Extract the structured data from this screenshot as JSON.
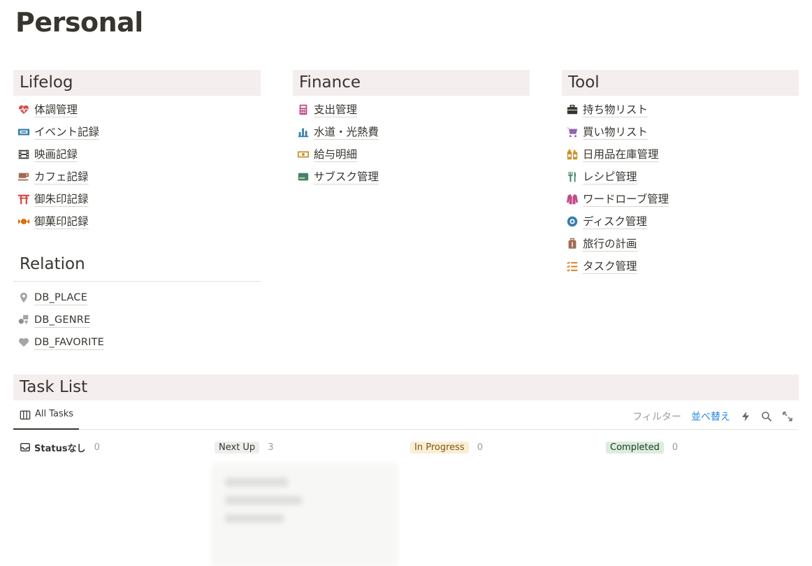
{
  "page": {
    "title": "Personal"
  },
  "lifelog": {
    "title": "Lifelog",
    "items": [
      {
        "label": "体調管理",
        "icon": "heart-pulse-icon",
        "color": "#d44c47"
      },
      {
        "label": "イベント記録",
        "icon": "ticket-icon",
        "color": "#337ea9"
      },
      {
        "label": "映画記録",
        "icon": "film-icon",
        "color": "#37352f"
      },
      {
        "label": "カフェ記録",
        "icon": "coffee-icon",
        "color": "#9f6b53"
      },
      {
        "label": "御朱印記録",
        "icon": "torii-icon",
        "color": "#d44c47"
      },
      {
        "label": "御菓印記録",
        "icon": "candy-icon",
        "color": "#d9730d"
      }
    ]
  },
  "relation": {
    "title": "Relation",
    "items": [
      {
        "label": "DB_PLACE",
        "icon": "location-pin-icon",
        "color": "#9b9a97"
      },
      {
        "label": "DB_GENRE",
        "icon": "shapes-icon",
        "color": "#9b9a97"
      },
      {
        "label": "DB_FAVORITE",
        "icon": "heart-icon",
        "color": "#9b9a97"
      }
    ]
  },
  "finance": {
    "title": "Finance",
    "items": [
      {
        "label": "支出管理",
        "icon": "calculator-icon",
        "color": "#c14c8a"
      },
      {
        "label": "水道・光熱費",
        "icon": "bar-chart-icon",
        "color": "#337ea9"
      },
      {
        "label": "給与明細",
        "icon": "money-icon",
        "color": "#cb912f"
      },
      {
        "label": "サブスク管理",
        "icon": "card-icon",
        "color": "#448361"
      }
    ]
  },
  "tool": {
    "title": "Tool",
    "items": [
      {
        "label": "持ち物リスト",
        "icon": "briefcase-icon",
        "color": "#37352f"
      },
      {
        "label": "買い物リスト",
        "icon": "cart-icon",
        "color": "#9065b0"
      },
      {
        "label": "日用品在庫管理",
        "icon": "bottles-icon",
        "color": "#cb912f"
      },
      {
        "label": "レシピ管理",
        "icon": "fork-knife-icon",
        "color": "#448361"
      },
      {
        "label": "ワードローブ管理",
        "icon": "jacket-icon",
        "color": "#c14c8a"
      },
      {
        "label": "ディスク管理",
        "icon": "disc-icon",
        "color": "#337ea9"
      },
      {
        "label": "旅行の計画",
        "icon": "suitcase-icon",
        "color": "#9f6b53"
      },
      {
        "label": "タスク管理",
        "icon": "checklist-icon",
        "color": "#d9730d"
      }
    ]
  },
  "tasks": {
    "title": "Task List",
    "view_label": "All Tasks",
    "toolbar": {
      "filter": "フィルター",
      "sort": "並べ替え"
    },
    "groups": [
      {
        "label": "Statusなし",
        "count": "0"
      },
      {
        "label": "Next Up",
        "count": "3"
      },
      {
        "label": "In Progress",
        "count": "0"
      },
      {
        "label": "Completed",
        "count": "0"
      }
    ]
  }
}
